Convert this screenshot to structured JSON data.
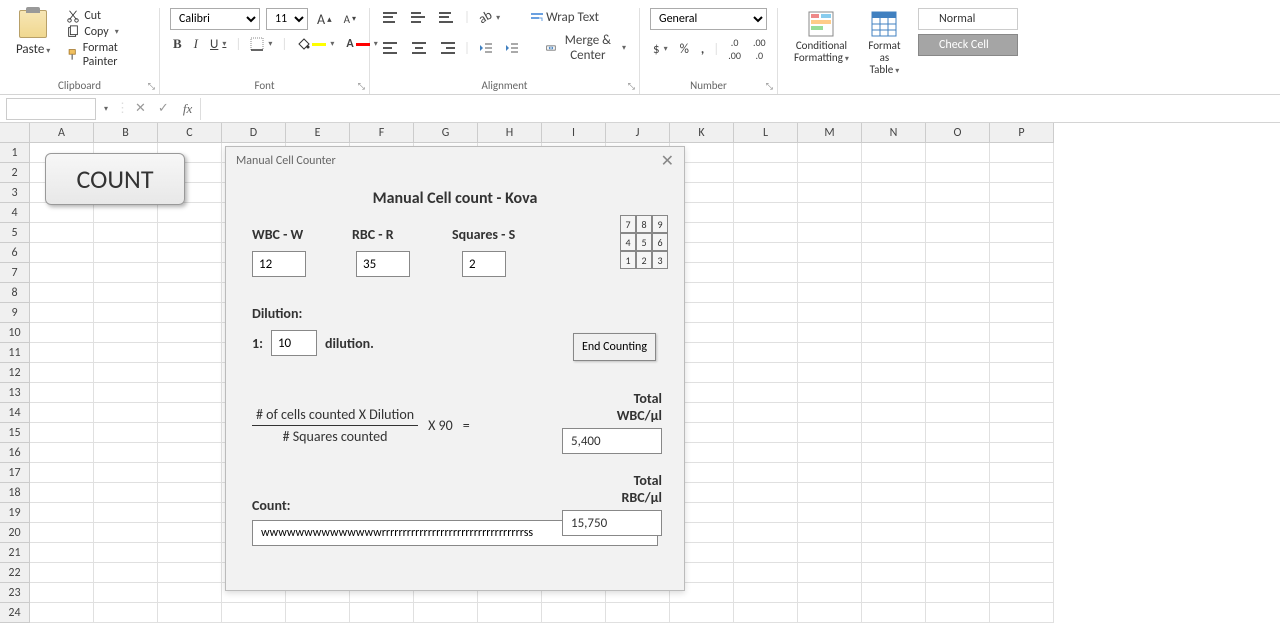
{
  "ribbon": {
    "clipboard": {
      "label": "Clipboard",
      "paste": "Paste",
      "cut": "Cut",
      "copy": "Copy",
      "format_painter": "Format Painter"
    },
    "font": {
      "label": "Font",
      "font_name": "Calibri",
      "font_size": "11",
      "increase": "A",
      "decrease": "A"
    },
    "alignment": {
      "label": "Alignment",
      "wrap": "Wrap Text",
      "merge": "Merge & Center"
    },
    "number": {
      "label": "Number",
      "format": "General"
    },
    "cond": "Conditional Formatting",
    "asTable": "Format as Table",
    "styles": {
      "normal": "Normal",
      "check": "Check Cell"
    }
  },
  "formula_bar": {
    "name_box": "",
    "formula": ""
  },
  "grid": {
    "cols": [
      "A",
      "B",
      "C",
      "D",
      "E",
      "F",
      "G",
      "H",
      "I",
      "J",
      "K",
      "L",
      "M",
      "N",
      "O",
      "P"
    ],
    "rows": 24
  },
  "count_button": "COUNT",
  "dialog": {
    "title": "Manual Cell Counter",
    "heading": "Manual Cell count - Kova",
    "wbc_label": "WBC - W",
    "rbc_label": "RBC - R",
    "squares_label": "Squares - S",
    "wbc": "12",
    "rbc": "35",
    "squares": "2",
    "keypad": [
      [
        "7",
        "8",
        "9"
      ],
      [
        "4",
        "5",
        "6"
      ],
      [
        "1",
        "2",
        "3"
      ]
    ],
    "end_counting": "End Counting",
    "dilution_label": "Dilution:",
    "dilution_prefix": "1:",
    "dilution_val": "10",
    "dilution_suffix": "dilution.",
    "formula_top": "# of cells counted  X  Dilution",
    "formula_bottom": "# Squares counted",
    "formula_mult": "X 90",
    "formula_eq": "=",
    "total_wbc_label": "Total WBC/µl",
    "total_wbc": "5,400",
    "total_rbc_label": "Total RBC/µl",
    "total_rbc": "15,750",
    "count_label": "Count:",
    "count_val": "wwwwwwwwwwwwwwrrrrrrrrrrrrrrrrrrrrrrrrrrrrrrrrrrss"
  }
}
